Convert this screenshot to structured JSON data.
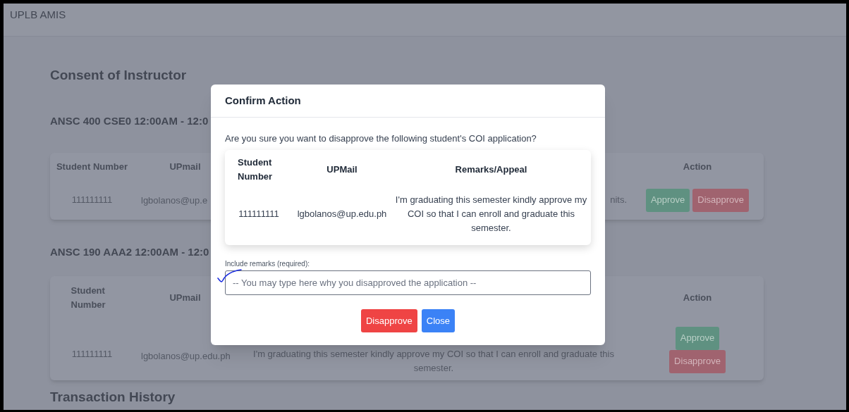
{
  "app_title": "UPLB AMIS",
  "page_title": "Consent of Instructor",
  "sections": [
    {
      "heading": "ANSC 400 CSE0 12:00AM - 12:0",
      "kind": "covered",
      "columns": [
        "Student Number",
        "UPmail",
        "Action"
      ],
      "rows": [
        {
          "student_number": "111111111",
          "upmail": "lgbolanos@up.e",
          "remarks": "nits.",
          "actions": [
            {
              "label": "Approve",
              "kind": "approve"
            },
            {
              "label": "Disapprove",
              "kind": "disapprove"
            }
          ]
        }
      ]
    },
    {
      "heading": "ANSC 190 AAA2 12:00AM - 12:0",
      "kind": "open",
      "columns": [
        "Student Number",
        "UPmail",
        "Action"
      ],
      "rows": [
        {
          "student_number": "111111111",
          "upmail": "lgbolanos@up.edu.ph",
          "remarks": "I'm graduating this semester kindly approve my COI so that I can enroll and graduate this semester.",
          "actions": [
            {
              "label": "Approve",
              "kind": "approve"
            },
            {
              "label": "Disapprove",
              "kind": "disapprove"
            }
          ]
        }
      ]
    }
  ],
  "next_heading": "Transaction History",
  "dialog": {
    "title": "Confirm Action",
    "message": "Are you sure you want to disapprove the following student's COI application?",
    "table": {
      "columns": [
        "Student Number",
        "UPMail",
        "Remarks/Appeal"
      ],
      "rows": [
        [
          "111111111",
          "lgbolanos@up.edu.ph",
          "I'm graduating this semester kindly approve my COI so that I can enroll and graduate this semester."
        ]
      ]
    },
    "remarks_label": "Include remarks (required):",
    "remarks_placeholder": "-- You may type here why you disapproved the application --",
    "buttons": [
      {
        "label": "Disapprove",
        "kind": "danger"
      },
      {
        "label": "Close",
        "kind": "primary"
      }
    ]
  }
}
